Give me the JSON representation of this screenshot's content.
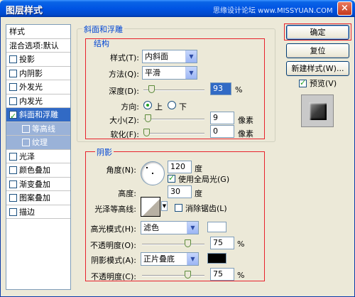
{
  "window": {
    "title": "图层样式",
    "watermark": "思缘设计论坛 www.MISSYUAN.COM"
  },
  "styles_list": {
    "header": "样式",
    "blend": "混合选项:默认",
    "items": [
      {
        "label": "投影",
        "checked": false
      },
      {
        "label": "内阴影",
        "checked": false
      },
      {
        "label": "外发光",
        "checked": false
      },
      {
        "label": "内发光",
        "checked": false
      },
      {
        "label": "斜面和浮雕",
        "checked": true
      },
      {
        "label": "等高线",
        "sub": true
      },
      {
        "label": "纹理",
        "sub": true
      },
      {
        "label": "光泽",
        "checked": false
      },
      {
        "label": "颜色叠加",
        "checked": false
      },
      {
        "label": "渐变叠加",
        "checked": false
      },
      {
        "label": "图案叠加",
        "checked": false
      },
      {
        "label": "描边",
        "checked": false
      }
    ]
  },
  "bevel": {
    "group_title": "斜面和浮雕",
    "structure_title": "结构",
    "style_label": "样式(T):",
    "style_value": "内斜面",
    "technique_label": "方法(Q):",
    "technique_value": "平滑",
    "depth_label": "深度(D):",
    "depth_value": "93",
    "depth_unit": "%",
    "depth_level": 0.09,
    "direction_label": "方向:",
    "dir_up": "上",
    "dir_down": "下",
    "size_label": "大小(Z):",
    "size_value": "9",
    "size_unit": "像素",
    "size_level": 0.03,
    "soften_label": "软化(F):",
    "soften_value": "0",
    "soften_unit": "像素",
    "soften_level": 0.0
  },
  "shading": {
    "title": "阴影",
    "angle_label": "角度(N):",
    "angle_value": "120",
    "angle_unit": "度",
    "global_light": "使用全局光(G)",
    "altitude_label": "高度:",
    "altitude_value": "30",
    "altitude_unit": "度",
    "gloss_label": "光泽等高线:",
    "antialias": "消除锯齿(L)",
    "highlight_label": "高光模式(H):",
    "highlight_value": "滤色",
    "highlight_color": "#ffffff",
    "hl_opacity_label": "不透明度(O):",
    "hl_opacity_value": "75",
    "hl_opacity_unit": "%",
    "hl_opacity_level": 0.75,
    "shadow_label": "阴影模式(A):",
    "shadow_value": "正片叠底",
    "shadow_color": "#000000",
    "sh_opacity_label": "不透明度(C):",
    "sh_opacity_value": "75",
    "sh_opacity_unit": "%",
    "sh_opacity_level": 0.75
  },
  "buttons": {
    "ok": "确定",
    "reset": "复位",
    "new_style": "新建样式(W)...",
    "preview": "预览(V)"
  },
  "colors": {
    "accent": "#316ac5",
    "highlight_box": "#e8222c",
    "legend": "#0046d5"
  }
}
